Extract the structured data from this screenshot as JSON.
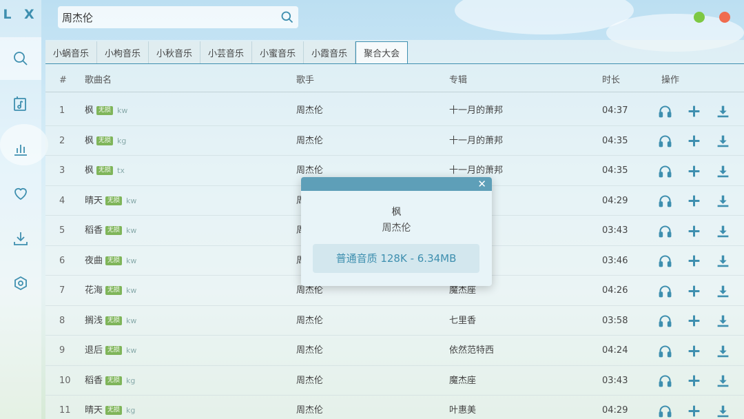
{
  "app": {
    "logo": "L X"
  },
  "search": {
    "value": "周杰伦"
  },
  "sidebar": {
    "items": [
      {
        "icon": "search-icon",
        "active": true
      },
      {
        "icon": "music-list-icon",
        "active": false
      },
      {
        "icon": "chart-icon",
        "active": false
      },
      {
        "icon": "heart-icon",
        "active": false
      },
      {
        "icon": "download-icon",
        "active": false
      },
      {
        "icon": "settings-icon",
        "active": false
      }
    ]
  },
  "window": {
    "minimize_color": "#7dc843",
    "close_color": "#f06c4f"
  },
  "tabs": [
    "小蜗音乐",
    "小枸音乐",
    "小秋音乐",
    "小芸音乐",
    "小蜜音乐",
    "小霞音乐",
    "聚合大会"
  ],
  "active_tab": 6,
  "table": {
    "headers": {
      "num": "#",
      "name": "歌曲名",
      "singer": "歌手",
      "album": "专辑",
      "duration": "时长",
      "ops": "操作"
    },
    "rows": [
      {
        "num": "1",
        "name": "枫",
        "badge": "无损",
        "source": "kw",
        "singer": "周杰伦",
        "album": "十一月的萧邦",
        "duration": "04:37"
      },
      {
        "num": "2",
        "name": "枫",
        "badge": "无损",
        "source": "kg",
        "singer": "周杰伦",
        "album": "十一月的萧邦",
        "duration": "04:35"
      },
      {
        "num": "3",
        "name": "枫",
        "badge": "无损",
        "source": "tx",
        "singer": "周杰伦",
        "album": "十一月的萧邦",
        "duration": "04:35"
      },
      {
        "num": "4",
        "name": "晴天",
        "badge": "无损",
        "source": "kw",
        "singer": "周",
        "album": "",
        "duration": "04:29"
      },
      {
        "num": "5",
        "name": "稻香",
        "badge": "无损",
        "source": "kw",
        "singer": "周",
        "album": "",
        "duration": "03:43"
      },
      {
        "num": "6",
        "name": "夜曲",
        "badge": "无损",
        "source": "kw",
        "singer": "周",
        "album": "萧邦",
        "duration": "03:46"
      },
      {
        "num": "7",
        "name": "花海",
        "badge": "无损",
        "source": "kw",
        "singer": "周杰伦",
        "album": "魔杰座",
        "duration": "04:26"
      },
      {
        "num": "8",
        "name": "搁浅",
        "badge": "无损",
        "source": "kw",
        "singer": "周杰伦",
        "album": "七里香",
        "duration": "03:58"
      },
      {
        "num": "9",
        "name": "退后",
        "badge": "无损",
        "source": "kw",
        "singer": "周杰伦",
        "album": "依然范特西",
        "duration": "04:24"
      },
      {
        "num": "10",
        "name": "稻香",
        "badge": "无损",
        "source": "kg",
        "singer": "周杰伦",
        "album": "魔杰座",
        "duration": "03:43"
      },
      {
        "num": "11",
        "name": "晴天",
        "badge": "无损",
        "source": "kg",
        "singer": "周杰伦",
        "album": "叶惠美",
        "duration": "04:29"
      }
    ]
  },
  "modal": {
    "title": "枫",
    "artist": "周杰伦",
    "close_label": "✕",
    "quality_label": "普通音质 128K - 6.34MB"
  },
  "colors": {
    "accent": "#3e8faf",
    "badge": "#7fb55a",
    "modal_header": "#5e9fb8"
  }
}
